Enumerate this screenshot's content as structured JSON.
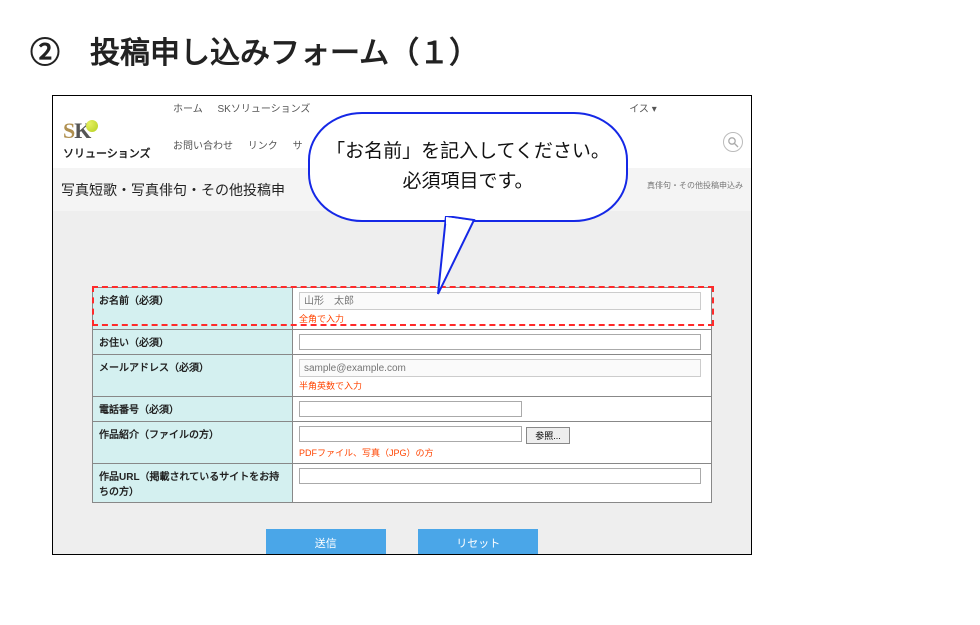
{
  "page": {
    "heading": "②　投稿申し込みフォーム（１）"
  },
  "nav": {
    "row1": [
      "ホーム",
      "SKソリューションズ",
      "",
      "",
      "イス ▾"
    ],
    "row2": [
      "お問い合わせ",
      "リンク",
      "サ"
    ]
  },
  "logo": {
    "brand_sub": "ソリューションズ"
  },
  "section": {
    "title": "写真短歌・写真俳句・その他投稿申",
    "breadcrumb_right": "真俳句・その他投稿申込み"
  },
  "callout": {
    "line1": "「お名前」を記入してください。",
    "line2": "必須項目です。"
  },
  "form": {
    "rows": {
      "name": {
        "label": "お名前（必須）",
        "placeholder": "山形　太郎",
        "hint": "全角で入力"
      },
      "addr": {
        "label": "お住い（必須）"
      },
      "email": {
        "label": "メールアドレス（必須）",
        "placeholder": "sample@example.com",
        "hint": "半角英数で入力"
      },
      "tel": {
        "label": "電話番号（必須）"
      },
      "file": {
        "label": "作品紹介（ファイルの方）",
        "browse": "参照...",
        "hint": "PDFファイル、写真（JPG）の方"
      },
      "url": {
        "label": "作品URL（掲載されているサイトをお持ちの方）"
      }
    },
    "buttons": {
      "submit": "送信",
      "reset": "リセット"
    }
  }
}
